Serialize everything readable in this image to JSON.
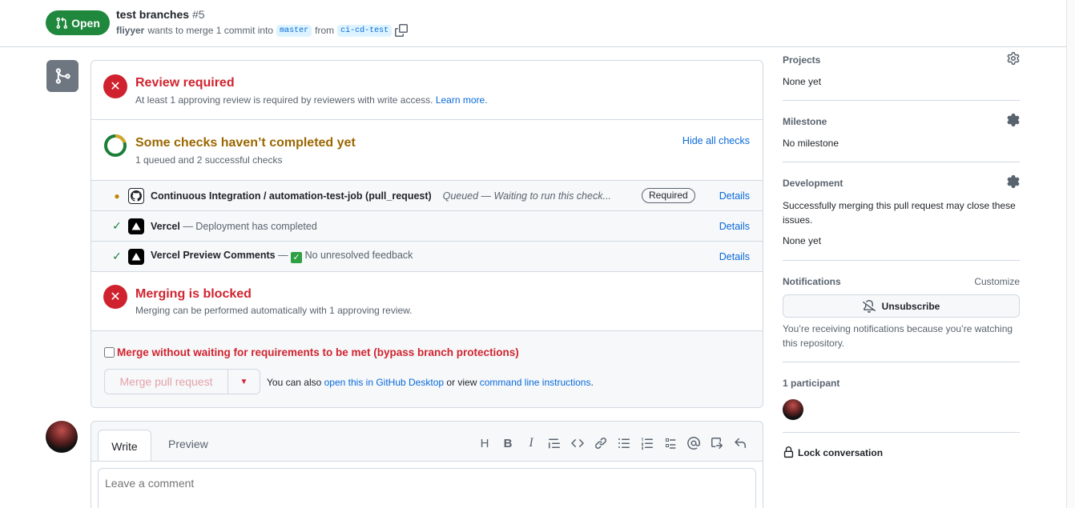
{
  "header": {
    "state_label": "Open",
    "title": "test branches",
    "number": "#5",
    "author": "fliyyer",
    "merge_text": "wants to merge 1 commit into",
    "base_branch": "master",
    "from_text": "from",
    "head_branch": "ci-cd-test"
  },
  "review": {
    "title": "Review required",
    "subtitle": "At least 1 approving review is required by reviewers with write access.",
    "learn_more": "Learn more."
  },
  "checks": {
    "title": "Some checks haven’t completed yet",
    "subtitle": "1 queued and 2 successful checks",
    "hide_label": "Hide all checks",
    "items": [
      {
        "name": "Continuous Integration / automation-test-job (pull_request)",
        "description": "Queued — Waiting to run this check...",
        "badge": "Required",
        "details": "Details",
        "status": "queued"
      },
      {
        "name": "Vercel",
        "description": "— Deployment has completed",
        "details": "Details",
        "status": "success"
      },
      {
        "name": "Vercel Preview Comments",
        "description_prefix": "—",
        "description": "No unresolved feedback",
        "details": "Details",
        "status": "success"
      }
    ]
  },
  "blocked": {
    "title": "Merging is blocked",
    "subtitle": "Merging can be performed automatically with 1 approving review."
  },
  "merge": {
    "bypass_label": "Merge without waiting for requirements to be met (bypass branch protections)",
    "button_label": "Merge pull request",
    "also_prefix": "You can also",
    "desktop_link": "open this in GitHub Desktop",
    "or_view": "or view",
    "cli_link": "command line instructions",
    "period": "."
  },
  "comment": {
    "tab_write": "Write",
    "tab_preview": "Preview",
    "placeholder": "Leave a comment"
  },
  "sidebar": {
    "projects": {
      "heading": "Projects",
      "value": "None yet"
    },
    "milestone": {
      "heading": "Milestone",
      "value": "No milestone"
    },
    "development": {
      "heading": "Development",
      "description": "Successfully merging this pull request may close these issues.",
      "value": "None yet"
    },
    "notifications": {
      "heading": "Notifications",
      "customize": "Customize",
      "unsubscribe": "Unsubscribe",
      "note": "You’re receiving notifications because you’re watching this repository."
    },
    "participants": {
      "heading": "1 participant"
    },
    "lock": "Lock conversation"
  },
  "colors": {
    "open_green": "#1f883d",
    "danger_red": "#cf222e",
    "pending_amber": "#9a6700",
    "link_blue": "#0969da"
  }
}
